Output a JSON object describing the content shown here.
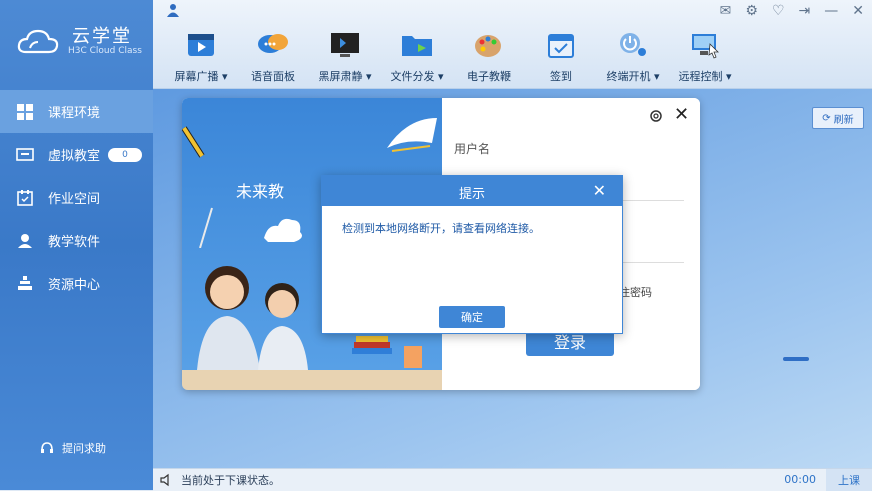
{
  "app": {
    "title_cn": "云学堂",
    "title_en": "H3C Cloud Class"
  },
  "sidebar": {
    "items": [
      {
        "label": "课程环境",
        "icon": "windows-icon"
      },
      {
        "label": "虚拟教室",
        "icon": "classroom-icon",
        "badge": "0"
      },
      {
        "label": "作业空间",
        "icon": "homework-icon"
      },
      {
        "label": "教学软件",
        "icon": "software-icon"
      },
      {
        "label": "资源中心",
        "icon": "resource-icon"
      }
    ],
    "help_label": "提问求助"
  },
  "toolbar": {
    "tools": [
      {
        "label": "屏幕广播 ▾",
        "icon": "broadcast-icon"
      },
      {
        "label": "语音面板",
        "icon": "voice-icon"
      },
      {
        "label": "黑屏肃静 ▾",
        "icon": "blackscreen-icon"
      },
      {
        "label": "文件分发 ▾",
        "icon": "file-icon"
      },
      {
        "label": "电子教鞭",
        "icon": "paint-icon"
      },
      {
        "label": "签到",
        "icon": "signin-icon"
      },
      {
        "label": "终端开机 ▾",
        "icon": "power-icon"
      },
      {
        "label": "远程控制 ▾",
        "icon": "remote-icon"
      }
    ]
  },
  "main": {
    "refresh_label": "刷新"
  },
  "login_card": {
    "slogan": "未来教",
    "username_label": "用户名",
    "remember_label": "记住密码",
    "login_button": "登录"
  },
  "dialog": {
    "title": "提示",
    "message": "检测到本地网络断开，请查看网络连接。",
    "ok_label": "确定"
  },
  "status_bar": {
    "text": "当前处于下课状态。",
    "timer": "00:00",
    "class_button": "上课"
  },
  "colors": {
    "accent": "#3f86d6",
    "sidebar": "#3a79c8"
  }
}
